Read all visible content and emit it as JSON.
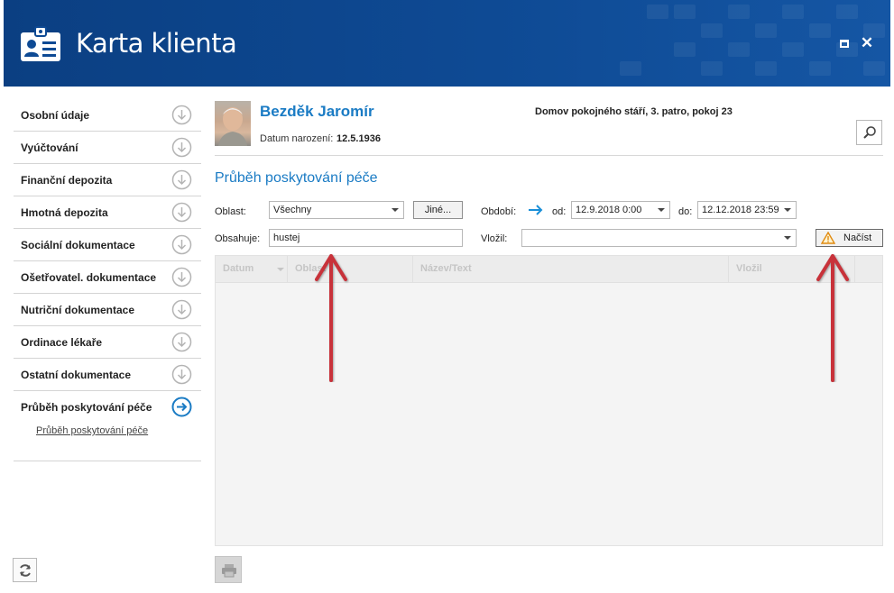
{
  "window": {
    "title": "Karta klienta"
  },
  "sidebar": {
    "items": [
      {
        "label": "Osobní údaje"
      },
      {
        "label": "Vyúčtování"
      },
      {
        "label": "Finanční depozita"
      },
      {
        "label": "Hmotná depozita"
      },
      {
        "label": "Sociální dokumentace"
      },
      {
        "label": "Ošetřovatel. dokumentace"
      },
      {
        "label": "Nutriční dokumentace"
      },
      {
        "label": "Ordinace lékaře"
      },
      {
        "label": "Ostatní dokumentace"
      },
      {
        "label": "Průběh poskytování péče"
      }
    ],
    "active_index": 9,
    "sub_link": "Průběh poskytování péče"
  },
  "patient": {
    "name": "Bezděk Jaromír",
    "dob_label": "Datum narození:",
    "dob": "12.5.1936",
    "location": "Domov pokojného stáří, 3. patro, pokoj 23"
  },
  "section": {
    "title": "Průběh poskytování péče"
  },
  "filters": {
    "oblast_label": "Oblast:",
    "oblast_value": "Všechny",
    "jine_button": "Jiné...",
    "obdobi_label": "Období:",
    "od_label": "od:",
    "od_value": "12.9.2018 0:00",
    "do_label": "do:",
    "do_value": "12.12.2018 23:59",
    "obsahuje_label": "Obsahuje:",
    "obsahuje_value": "hustej",
    "vlozil_label": "Vložil:",
    "vlozil_value": "",
    "nacist_button": "Načíst"
  },
  "grid": {
    "columns": [
      "Datum",
      "Oblast",
      "Název/Text",
      "Vložil"
    ],
    "rows": []
  },
  "colors": {
    "header_bg": "#0e4a94",
    "accent": "#1a7bc4",
    "annotation": "#d0303a",
    "warning": "#e8a21a"
  }
}
